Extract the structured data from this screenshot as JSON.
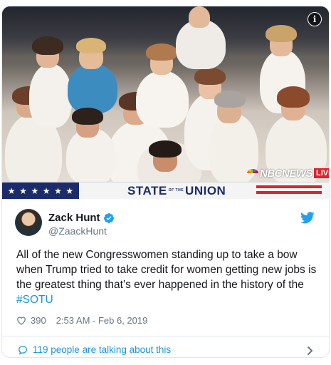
{
  "media": {
    "info_icon": "info-icon",
    "info_label": "i",
    "network": "NBCNEWS",
    "live_label": "LIVE",
    "banner_title_left": "STATE",
    "banner_title_of": "OF THE",
    "banner_title_right": "UNION",
    "stars": [
      "★",
      "★",
      "★",
      "★",
      "★",
      "★"
    ]
  },
  "tweet": {
    "display_name": "Zack Hunt",
    "handle": "@ZaackHunt",
    "verified_icon": "verified-badge-icon",
    "platform_icon": "twitter-bird-icon",
    "text": "All of the new Congresswomen standing up to take a bow when Trump tried to take credit for women getting new jobs is the greatest thing that’s ever happened in the history of the ",
    "hashtag": "#SOTU",
    "like_count": "390",
    "timestamp": "2:53 AM - Feb 6, 2019",
    "talking_label": "119 people are talking about this"
  },
  "colors": {
    "link": "#1b95e0",
    "text": "#14171a",
    "muted": "#657786",
    "border": "#e1e8ed",
    "banner_navy": "#1b2b6b",
    "banner_red": "#d7262e"
  }
}
